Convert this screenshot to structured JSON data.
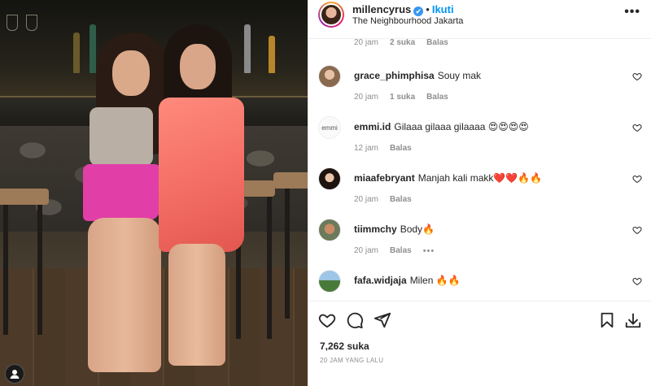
{
  "post": {
    "username": "millencyrus",
    "verified_mark": "✔",
    "separator": "•",
    "follow_label": "Ikuti",
    "location": "The Neighbourhood Jakarta",
    "more_label": "•••"
  },
  "top_meta": {
    "time": "20 jam",
    "likes": "2 suka",
    "reply": "Balas"
  },
  "comments": [
    {
      "username": "grace_phimphisa",
      "text": "Souy mak",
      "time": "20 jam",
      "likes": "1 suka",
      "reply": "Balas",
      "avatar": "avatar-grace"
    },
    {
      "username": "emmi.id",
      "text": "Gilaaa gilaaa gilaaaa 😍😍😍😍",
      "time": "12 jam",
      "likes": "",
      "reply": "Balas",
      "avatar": "avatar-emmi",
      "avatar_text": "emmi"
    },
    {
      "username": "miaafebryant",
      "text": "Manjah kali makk❤️❤️🔥🔥",
      "time": "20 jam",
      "likes": "",
      "reply": "Balas",
      "avatar": "avatar-miaa"
    },
    {
      "username": "tiimmchy",
      "text": "Body🔥",
      "time": "20 jam",
      "likes": "",
      "reply": "Balas",
      "more": "•••",
      "avatar": "avatar-tiimm"
    },
    {
      "username": "fafa.widjaja",
      "text": "Milen 🔥🔥",
      "time": "",
      "likes": "",
      "reply": "",
      "avatar": "avatar-fafa"
    }
  ],
  "footer": {
    "likes_count": "7,262 suka",
    "posted_time": "20 JAM YANG LALU"
  },
  "icons": [
    "heart-icon",
    "comment-icon",
    "share-icon",
    "bookmark-icon",
    "download-icon",
    "user-icon",
    "more-icon"
  ],
  "colors": {
    "accent": "#0095f6",
    "verified": "#3897f0",
    "muted": "#8e8e8e",
    "text": "#262626"
  }
}
